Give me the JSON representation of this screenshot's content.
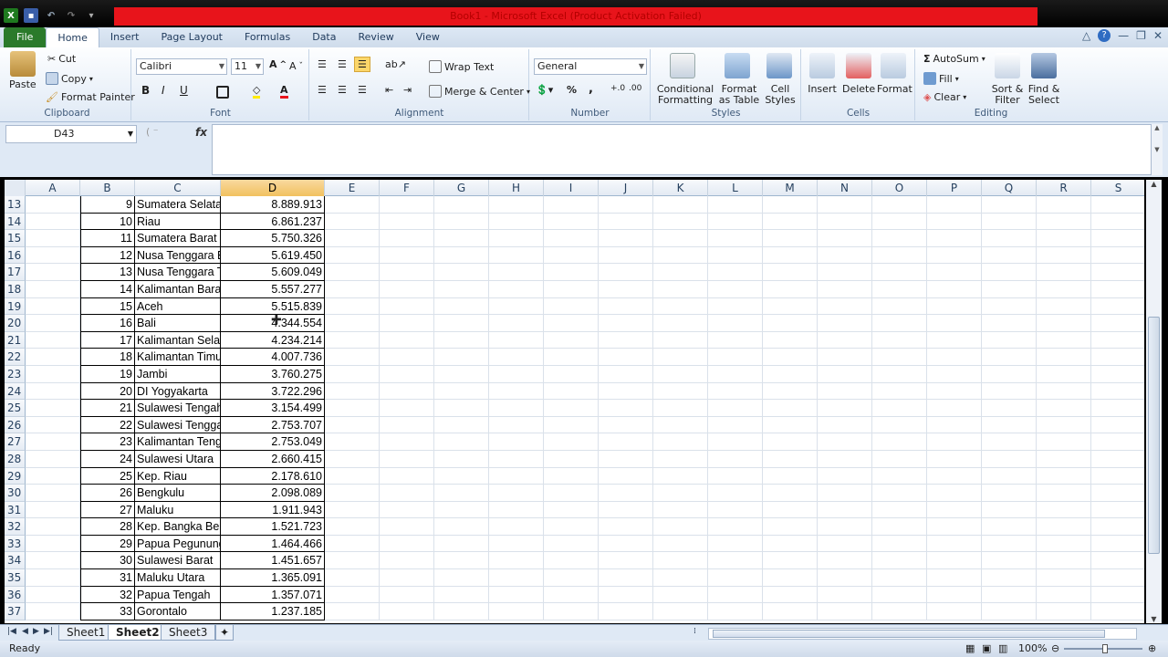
{
  "window": {
    "title": "Book1 - Microsoft Excel (Product Activation Failed)"
  },
  "tabs": [
    "File",
    "Home",
    "Insert",
    "Page Layout",
    "Formulas",
    "Data",
    "Review",
    "View"
  ],
  "ribbon": {
    "clipboard": {
      "paste": "Paste",
      "cut": "Cut",
      "copy": "Copy",
      "format_painter": "Format Painter",
      "label": "Clipboard"
    },
    "font": {
      "name": "Calibri",
      "size": "11",
      "bold": "B",
      "italic": "I",
      "underline": "U",
      "label": "Font"
    },
    "alignment": {
      "wrap": "Wrap Text",
      "merge": "Merge & Center",
      "label": "Alignment"
    },
    "number": {
      "format": "General",
      "percent": "%",
      "comma": ",",
      "label": "Number"
    },
    "styles": {
      "conditional": "Conditional\nFormatting",
      "table": "Format\nas Table",
      "cell": "Cell\nStyles",
      "label": "Styles"
    },
    "cells": {
      "insert": "Insert",
      "delete": "Delete",
      "format": "Format",
      "label": "Cells"
    },
    "editing": {
      "autosum": "AutoSum",
      "fill": "Fill",
      "clear": "Clear",
      "sort": "Sort &\nFilter",
      "find": "Find &\nSelect",
      "label": "Editing"
    }
  },
  "formula_bar": {
    "name_box": "D43",
    "fx": "fx",
    "formula": ""
  },
  "columns": [
    "A",
    "B",
    "C",
    "D",
    "E",
    "F",
    "G",
    "H",
    "I",
    "J",
    "K",
    "L",
    "M",
    "N",
    "O",
    "P",
    "Q",
    "R",
    "S"
  ],
  "selected_column": "D",
  "rows": [
    {
      "r": "13",
      "b": "9",
      "c": "Sumatera Selatan",
      "d": "8.889.913"
    },
    {
      "r": "14",
      "b": "10",
      "c": "Riau",
      "d": "6.861.237"
    },
    {
      "r": "15",
      "b": "11",
      "c": "Sumatera Barat",
      "d": "5.750.326"
    },
    {
      "r": "16",
      "b": "12",
      "c": "Nusa Tenggara Barat",
      "d": "5.619.450"
    },
    {
      "r": "17",
      "b": "13",
      "c": "Nusa Tenggara Timur",
      "d": "5.609.049"
    },
    {
      "r": "18",
      "b": "14",
      "c": "Kalimantan Barat",
      "d": "5.557.277"
    },
    {
      "r": "19",
      "b": "15",
      "c": "Aceh",
      "d": "5.515.839"
    },
    {
      "r": "20",
      "b": "16",
      "c": "Bali",
      "d": "4.344.554"
    },
    {
      "r": "21",
      "b": "17",
      "c": "Kalimantan Selatan",
      "d": "4.234.214"
    },
    {
      "r": "22",
      "b": "18",
      "c": "Kalimantan Timur",
      "d": "4.007.736"
    },
    {
      "r": "23",
      "b": "19",
      "c": "Jambi",
      "d": "3.760.275"
    },
    {
      "r": "24",
      "b": "20",
      "c": "DI Yogyakarta",
      "d": "3.722.296"
    },
    {
      "r": "25",
      "b": "21",
      "c": "Sulawesi Tengah",
      "d": "3.154.499"
    },
    {
      "r": "26",
      "b": "22",
      "c": "Sulawesi Tenggara",
      "d": "2.753.707"
    },
    {
      "r": "27",
      "b": "23",
      "c": "Kalimantan Tengah",
      "d": "2.753.049"
    },
    {
      "r": "28",
      "b": "24",
      "c": "Sulawesi Utara",
      "d": "2.660.415"
    },
    {
      "r": "29",
      "b": "25",
      "c": "Kep. Riau",
      "d": "2.178.610"
    },
    {
      "r": "30",
      "b": "26",
      "c": "Bengkulu",
      "d": "2.098.089"
    },
    {
      "r": "31",
      "b": "27",
      "c": "Maluku",
      "d": "1.911.943"
    },
    {
      "r": "32",
      "b": "28",
      "c": "Kep. Bangka Belitung",
      "d": "1.521.723"
    },
    {
      "r": "33",
      "b": "29",
      "c": "Papua Pegunungan",
      "d": "1.464.466"
    },
    {
      "r": "34",
      "b": "30",
      "c": "Sulawesi Barat",
      "d": "1.451.657"
    },
    {
      "r": "35",
      "b": "31",
      "c": "Maluku Utara",
      "d": "1.365.091"
    },
    {
      "r": "36",
      "b": "32",
      "c": "Papua Tengah",
      "d": "1.357.071"
    },
    {
      "r": "37",
      "b": "33",
      "c": "Gorontalo",
      "d": "1.237.185"
    }
  ],
  "sheets": [
    "Sheet1",
    "Sheet2",
    "Sheet3"
  ],
  "active_sheet": "Sheet2",
  "status": {
    "ready": "Ready",
    "zoom": "100%"
  },
  "colors": {
    "title_bar": "#e8141b",
    "file_tab": "#2b7a2b",
    "selected_header": "#f1c15f",
    "ribbon": "#dfe9f5"
  }
}
